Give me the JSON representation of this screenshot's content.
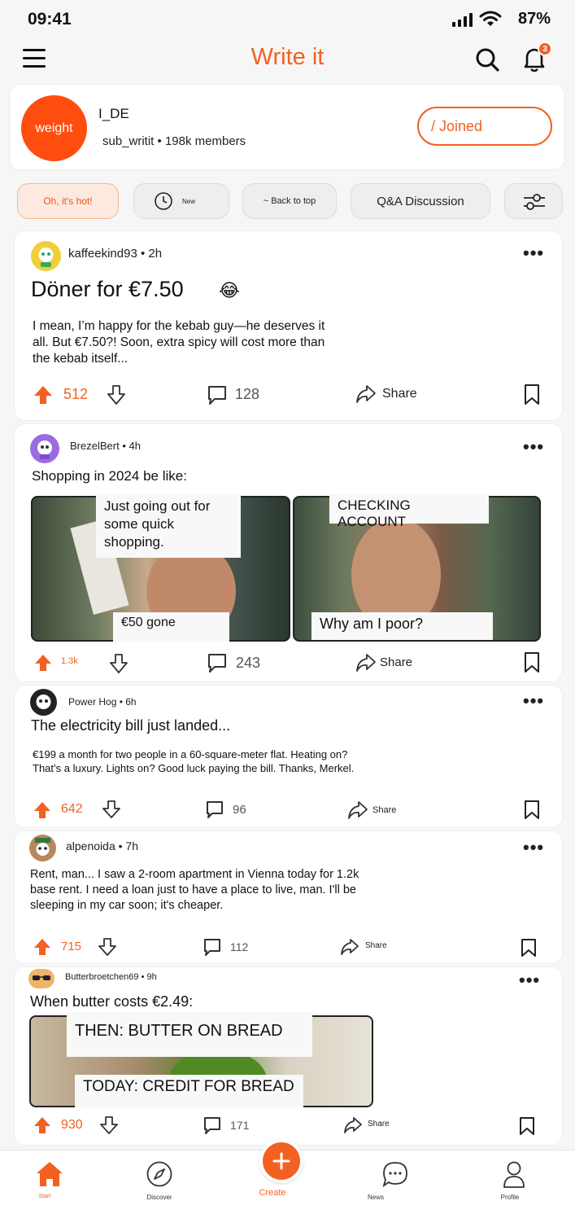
{
  "status": {
    "time": "09:41",
    "battery": "87%"
  },
  "app": {
    "title": "Write it",
    "notification_count": "3"
  },
  "community": {
    "avatar_text": "weight",
    "name": "I_DE",
    "handle": "sub_writit",
    "separator": "•",
    "members": "198k members",
    "joined_label": "/ Joined"
  },
  "filters": [
    {
      "label": "Oh, it's hot!",
      "active": true
    },
    {
      "label": "New",
      "icon": "clock-icon"
    },
    {
      "label": "~ Back to top"
    },
    {
      "label": "Q&A Discussion"
    },
    {
      "label": "",
      "icon": "sliders-icon"
    }
  ],
  "posts": [
    {
      "author": "kaffeekind93",
      "age": "2h",
      "title": "Döner for €7.50",
      "emoji": "😂",
      "body": "I mean, I’m happy for the kebab guy—he deserves it all. But €7.50?! Soon, extra spicy will cost more than the kebab itself...",
      "votes": "512",
      "comments": "128",
      "share": "Share"
    },
    {
      "author": "BrezelBert",
      "age": "4h",
      "title": "Shopping in 2024 be like:",
      "meme_captions": [
        "Just going out for some quick shopping.",
        "€50 gone",
        "CHECKING ACCOUNT",
        "Why am I poor?"
      ],
      "votes": "1.3k",
      "comments": "243",
      "share": "Share"
    },
    {
      "author": "Power Hog",
      "age": "6h",
      "title": "The electricity bill just landed...",
      "body": "€199 a month for two people in a 60-square-meter flat. Heating on? That’s a luxury. Lights on? Good luck paying the bill. Thanks, Merkel.",
      "votes": "642",
      "comments": "96",
      "share": "Share"
    },
    {
      "author": "alpenoida",
      "age": "7h",
      "body": "Rent, man... I saw a 2-room apartment in Vienna today for 1.2k base rent. I need a loan just to have a place to live, man. I'll be sleeping in my car soon; it's cheaper.",
      "votes": "715",
      "comments": "112",
      "share": "Share"
    },
    {
      "author": "Butterbroetchen69",
      "age": "9h",
      "title": "When butter costs €2.49:",
      "meme_captions": [
        "THEN: BUTTER ON BREAD",
        "TODAY: CREDIT FOR BREAD"
      ],
      "votes": "930",
      "comments": "171",
      "share": "Share"
    }
  ],
  "nav": [
    {
      "label": "Start",
      "icon": "home-icon",
      "active": true
    },
    {
      "label": "Discover",
      "icon": "compass-icon"
    },
    {
      "label": "Create",
      "icon": "plus-icon"
    },
    {
      "label": "News",
      "icon": "chat-bubble-icon"
    },
    {
      "label": "Profile",
      "icon": "person-icon"
    }
  ],
  "colors": {
    "accent": "#f26122",
    "background": "#f6f6f6"
  }
}
